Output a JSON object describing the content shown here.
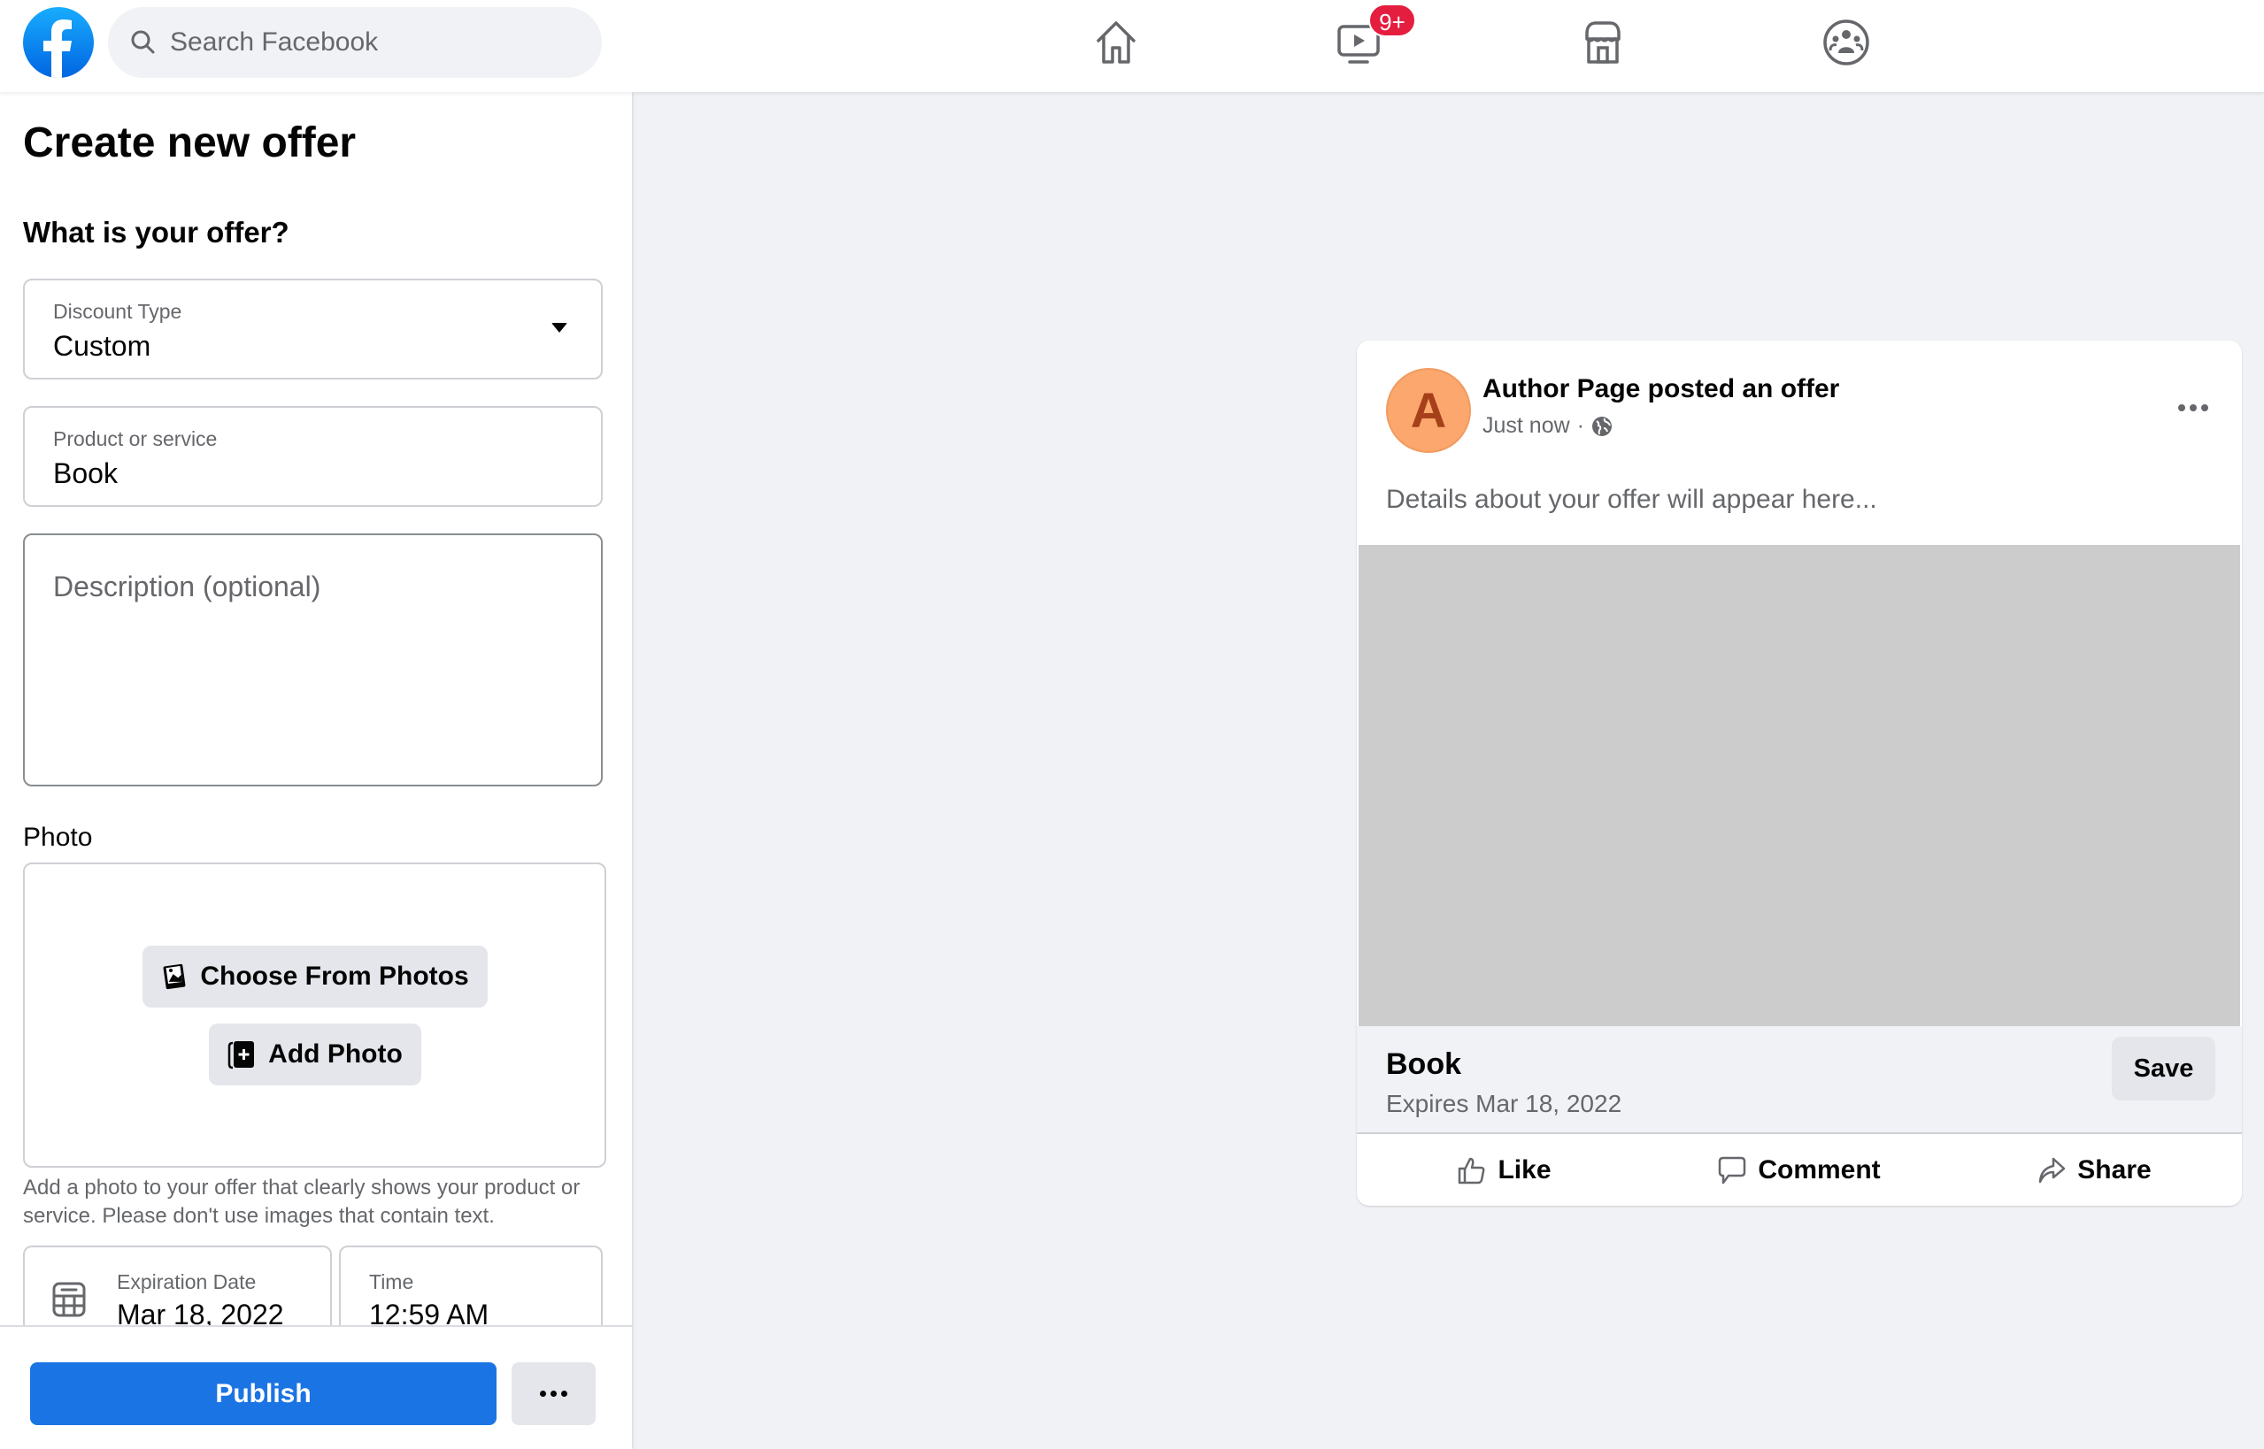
{
  "topbar": {
    "search_placeholder": "Search Facebook",
    "nav": [
      {
        "name": "home",
        "icon": "home-icon"
      },
      {
        "name": "watch",
        "icon": "video-icon",
        "badge": "9+"
      },
      {
        "name": "marketplace",
        "icon": "marketplace-icon"
      },
      {
        "name": "groups",
        "icon": "groups-icon"
      }
    ]
  },
  "form": {
    "title": "Create new offer",
    "subtitle": "What is your offer?",
    "discount_type": {
      "label": "Discount Type",
      "value": "Custom"
    },
    "product": {
      "label": "Product or service",
      "value": "Book"
    },
    "description": {
      "placeholder": "Description (optional)",
      "value": ""
    },
    "photo": {
      "label": "Photo",
      "choose_label": "Choose From Photos",
      "add_label": "Add Photo",
      "help": "Add a photo to your offer that clearly shows your product or service. Please don't use images that contain text."
    },
    "expiration_date": {
      "label": "Expiration Date",
      "value": "Mar 18, 2022"
    },
    "time": {
      "label": "Time",
      "value": "12:59 AM"
    },
    "publish_label": "Publish"
  },
  "preview": {
    "avatar_letter": "A",
    "post_title": "Author Page posted an offer",
    "timestamp": "Just now",
    "separator": "·",
    "details": "Details about your offer will appear here...",
    "product_name": "Book",
    "expires": "Expires Mar 18, 2022",
    "save_label": "Save",
    "actions": {
      "like": "Like",
      "comment": "Comment",
      "share": "Share"
    }
  },
  "colors": {
    "brand": "#1b74e4",
    "badge": "#e41e3f",
    "avatar": "#fba76d"
  }
}
